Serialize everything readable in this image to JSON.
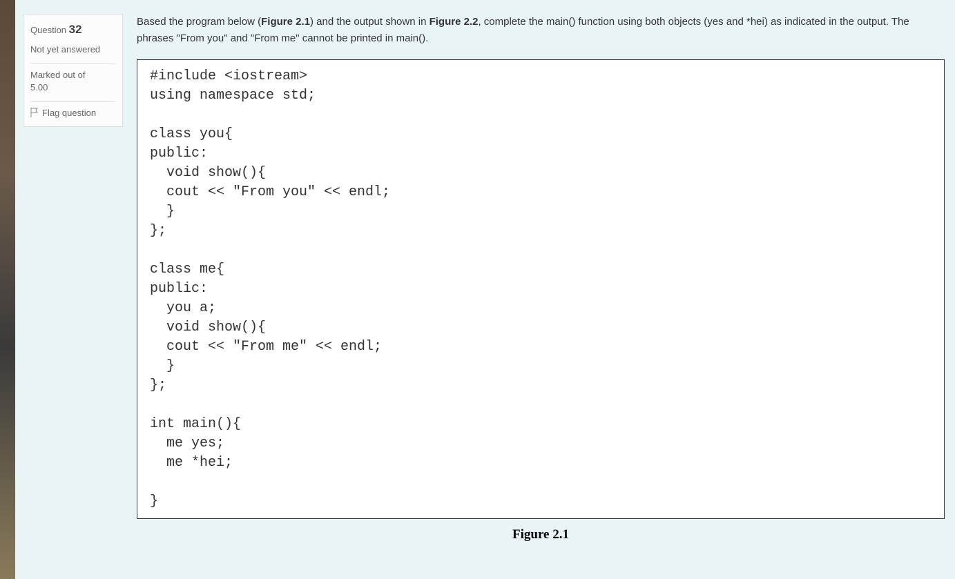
{
  "sidebar": {
    "question_label": "Question",
    "question_number": "32",
    "status": "Not yet answered",
    "marked_label": "Marked out of",
    "marked_value": "5.00",
    "flag_text": "Flag question"
  },
  "question": {
    "intro_text_1": "Based the program below (",
    "figure_ref_1": "Figure 2.1",
    "intro_text_2": ") and the output shown in ",
    "figure_ref_2": "Figure 2.2",
    "intro_text_3": ", complete the main() function using both objects (yes and *hei) as indicated in the output. The phrases \"From you\" and \"From me\" cannot be printed in main()."
  },
  "code": "#include <iostream>\nusing namespace std;\n\nclass you{\npublic:\n  void show(){\n  cout << \"From you\" << endl;\n  }\n};\n\nclass me{\npublic:\n  you a;\n  void show(){\n  cout << \"From me\" << endl;\n  }\n};\n\nint main(){\n  me yes;\n  me *hei;\n\n}",
  "figure_caption": "Figure 2.1"
}
